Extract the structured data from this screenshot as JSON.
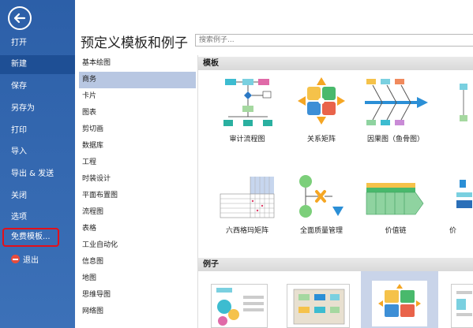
{
  "sidebar": {
    "items": [
      {
        "label": "打开"
      },
      {
        "label": "新建"
      },
      {
        "label": "保存"
      },
      {
        "label": "另存为"
      },
      {
        "label": "打印"
      },
      {
        "label": "导入"
      },
      {
        "label": "导出 & 发送"
      },
      {
        "label": "关闭"
      },
      {
        "label": "选项"
      },
      {
        "label": "免费模板..."
      },
      {
        "label": "退出"
      }
    ],
    "active": "新建"
  },
  "header": {
    "title": "预定义模板和例子",
    "search_placeholder": "搜索例子..."
  },
  "categories": [
    "基本绘图",
    "商务",
    "卡片",
    "图表",
    "剪切画",
    "数据库",
    "工程",
    "时装设计",
    "平面布置图",
    "流程图",
    "表格",
    "工业自动化",
    "信息图",
    "地图",
    "思维导图",
    "网络图"
  ],
  "selected_category": "商务",
  "sections": {
    "templates": "模板",
    "examples": "例子"
  },
  "templates": [
    {
      "label": "审计流程图"
    },
    {
      "label": "关系矩阵"
    },
    {
      "label": "因果图（鱼骨图）"
    },
    {
      "label": "六西格玛矩阵"
    },
    {
      "label": "全面质量管理"
    },
    {
      "label": "价值链"
    },
    {
      "label": "价"
    }
  ],
  "colors": {
    "sidebar": "#2c5fa8",
    "active_menu": "#1e4f95",
    "selected_category": "#b8c7e2",
    "highlight_border": "#e3101a"
  }
}
